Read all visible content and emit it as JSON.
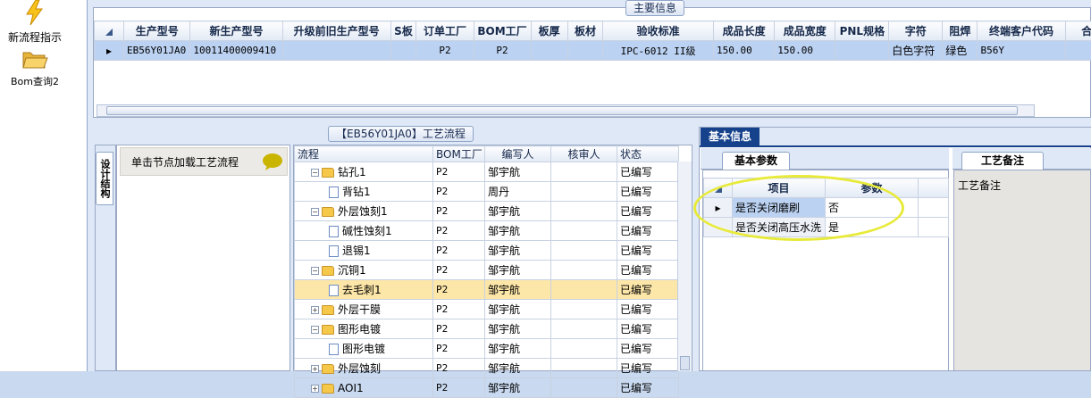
{
  "launcher": {
    "items": [
      {
        "label": "新流程指示",
        "icon": "lightning-icon"
      },
      {
        "label": "Bom查询2",
        "icon": "folder-open-icon"
      }
    ]
  },
  "main_info": {
    "section_title": "主要信息",
    "columns": [
      "生产型号",
      "新生产型号",
      "升级前旧生产型号",
      "S板",
      "订单工厂",
      "BOM工厂",
      "板厚",
      "板材",
      "验收标准",
      "成品长度",
      "成品宽度",
      "PNL规格",
      "字符",
      "阻焊",
      "终端客户代码",
      "合拼型"
    ],
    "rows": [
      [
        "EB56Y01JA0",
        "10011400009410",
        "",
        "",
        "P2",
        "P2",
        "",
        "",
        "IPC-6012 II级",
        "150.00",
        "150.00",
        "",
        "白色字符",
        "绿色",
        "B56Y",
        ""
      ]
    ]
  },
  "process_flow": {
    "title": "【EB56Y01JA0】工艺流程",
    "side_tab_label": "设计结构",
    "hint": "单击节点加载工艺流程",
    "columns": [
      "流程",
      "BOM工厂",
      "编写人",
      "核审人",
      "状态"
    ],
    "rows": [
      {
        "name": "钻孔1",
        "type": "folder",
        "level": 1,
        "expander": "−",
        "factory": "P2",
        "writer": "邹宇航",
        "reviewer": "",
        "status": "已编写"
      },
      {
        "name": "背钻1",
        "type": "doc",
        "level": 2,
        "expander": "",
        "factory": "P2",
        "writer": "周丹",
        "reviewer": "",
        "status": "已编写"
      },
      {
        "name": "外层蚀刻1",
        "type": "folder",
        "level": 1,
        "expander": "−",
        "factory": "P2",
        "writer": "邹宇航",
        "reviewer": "",
        "status": "已编写"
      },
      {
        "name": "碱性蚀刻1",
        "type": "doc",
        "level": 2,
        "expander": "",
        "factory": "P2",
        "writer": "邹宇航",
        "reviewer": "",
        "status": "已编写"
      },
      {
        "name": "退锡1",
        "type": "doc",
        "level": 2,
        "expander": "",
        "factory": "P2",
        "writer": "邹宇航",
        "reviewer": "",
        "status": "已编写"
      },
      {
        "name": "沉铜1",
        "type": "folder",
        "level": 1,
        "expander": "−",
        "factory": "P2",
        "writer": "邹宇航",
        "reviewer": "",
        "status": "已编写"
      },
      {
        "name": "去毛刺1",
        "type": "doc",
        "level": 2,
        "expander": "",
        "factory": "P2",
        "writer": "邹宇航",
        "reviewer": "",
        "status": "已编写",
        "selected": true
      },
      {
        "name": "外层干膜",
        "type": "folder",
        "level": 1,
        "expander": "+",
        "factory": "P2",
        "writer": "邹宇航",
        "reviewer": "",
        "status": "已编写"
      },
      {
        "name": "图形电镀",
        "type": "folder",
        "level": 1,
        "expander": "−",
        "factory": "P2",
        "writer": "邹宇航",
        "reviewer": "",
        "status": "已编写"
      },
      {
        "name": "图形电镀",
        "type": "doc",
        "level": 2,
        "expander": "",
        "factory": "P2",
        "writer": "邹宇航",
        "reviewer": "",
        "status": "已编写"
      },
      {
        "name": "外层蚀刻",
        "type": "folder",
        "level": 1,
        "expander": "+",
        "factory": "P2",
        "writer": "邹宇航",
        "reviewer": "",
        "status": "已编写"
      },
      {
        "name": "AOI1",
        "type": "folder",
        "level": 1,
        "expander": "+",
        "factory": "P2",
        "writer": "邹宇航",
        "reviewer": "",
        "status": "已编写"
      }
    ]
  },
  "basic_info": {
    "tab_label": "基本信息",
    "params_tab": "基本参数",
    "remark_tab": "工艺备注",
    "remark_label": "工艺备注",
    "params_columns": [
      "项目",
      "参数"
    ],
    "params_rows": [
      [
        "是否关闭磨刷",
        "否"
      ],
      [
        "是否关闭高压水洗",
        "是"
      ]
    ]
  },
  "colors": {
    "accent": "#15428b",
    "selection": "#bcd2f2",
    "tree_selection": "#fce6a8",
    "highlight": "#e8ea3a"
  }
}
